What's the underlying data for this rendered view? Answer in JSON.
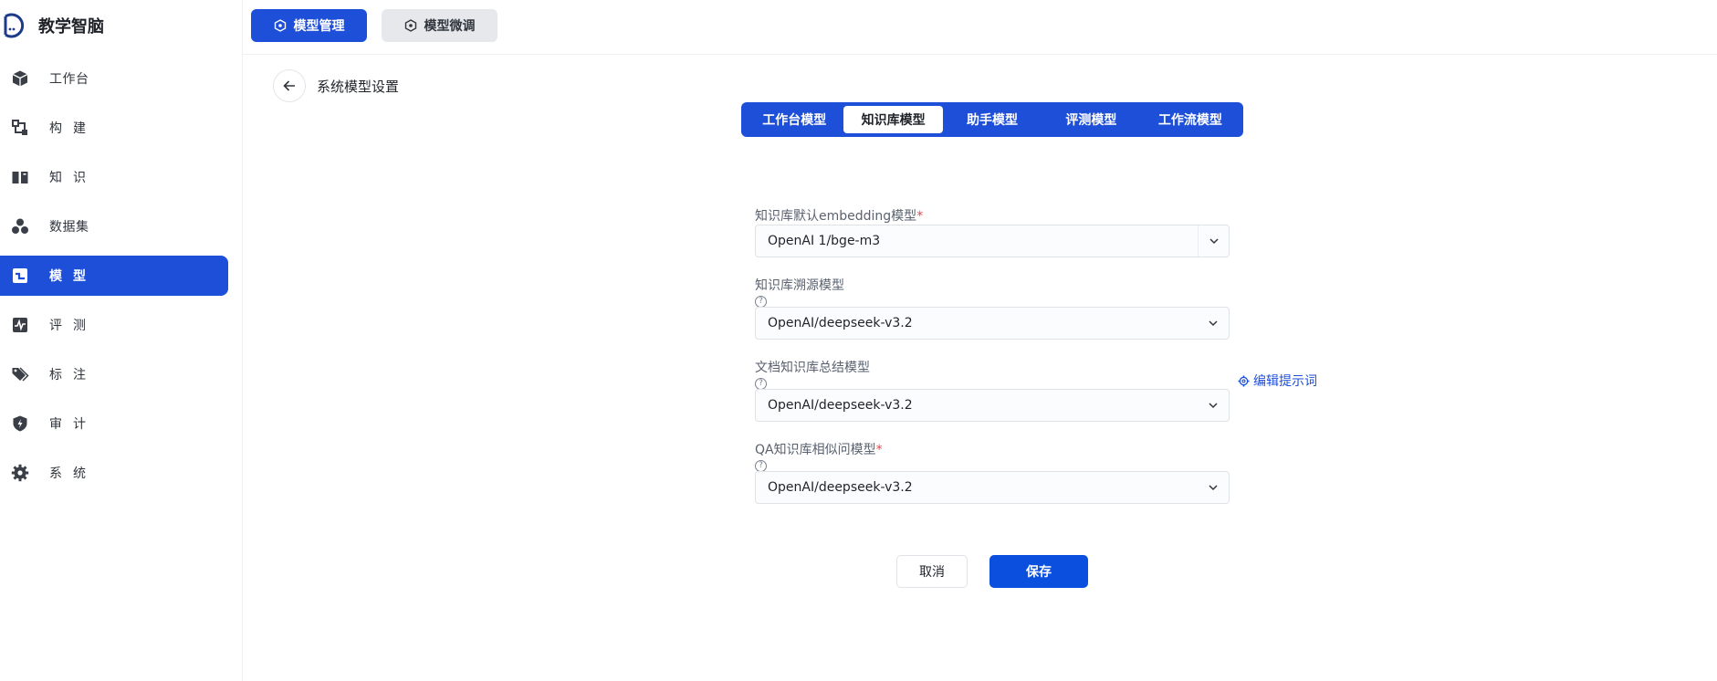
{
  "app": {
    "name": "教学智脑"
  },
  "sidebar": {
    "items": [
      {
        "label": "工作台",
        "icon": "cube-icon",
        "active": false
      },
      {
        "label": "构建",
        "icon": "build-icon",
        "active": false
      },
      {
        "label": "知识",
        "icon": "book-icon",
        "active": false
      },
      {
        "label": "数据集",
        "icon": "dataset-icon",
        "active": false
      },
      {
        "label": "模型",
        "icon": "model-icon",
        "active": true
      },
      {
        "label": "评测",
        "icon": "chart-pulse-icon",
        "active": false
      },
      {
        "label": "标注",
        "icon": "tag-icon",
        "active": false
      },
      {
        "label": "审计",
        "icon": "shield-bolt-icon",
        "active": false
      },
      {
        "label": "系统",
        "icon": "gear-icon",
        "active": false
      }
    ]
  },
  "topbar": {
    "model_manage": "模型管理",
    "model_finetune": "模型微调"
  },
  "page": {
    "title": "系统模型设置"
  },
  "tabs": [
    {
      "label": "工作台模型",
      "active": false
    },
    {
      "label": "知识库模型",
      "active": true
    },
    {
      "label": "助手模型",
      "active": false
    },
    {
      "label": "评测模型",
      "active": false
    },
    {
      "label": "工作流模型",
      "active": false
    }
  ],
  "form": {
    "fields": [
      {
        "label": "知识库默认embedding模型",
        "required_mark": "*",
        "value": "OpenAI 1/bge-m3"
      },
      {
        "label": "知识库溯源模型",
        "help": "?",
        "value": "OpenAI/deepseek-v3.2"
      },
      {
        "label": "文档知识库总结模型",
        "help": "?",
        "value": "OpenAI/deepseek-v3.2"
      },
      {
        "label": "QA知识库相似问模型",
        "required_mark": "*",
        "help": "?",
        "value": "OpenAI/deepseek-v3.2"
      }
    ],
    "edit_prompt": "编辑提示词",
    "cancel": "取消",
    "save": "保存"
  },
  "colors": {
    "primary": "#1e4fd8",
    "save": "#0b4fdf",
    "required": "#e5484d"
  }
}
